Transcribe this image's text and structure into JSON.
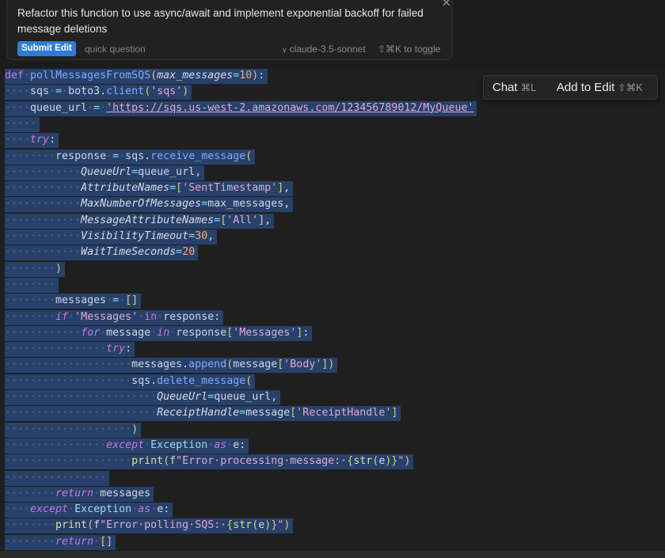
{
  "edit_panel": {
    "prompt": "Refactor this function to use async/await and implement exponential backoff for failed message deletions",
    "submit_label": "Submit Edit",
    "quick_question": "quick question",
    "model": "claude-3.5-sonnet",
    "toggle_hint": "⇧⌘K to toggle",
    "close_icon": "close-icon"
  },
  "chat_popup": {
    "chat_label": "Chat",
    "chat_shortcut": "⌘L",
    "add_label": "Add to Edit",
    "add_shortcut": "⇧⌘K"
  },
  "colors": {
    "selection": "#27416a",
    "submit": "#2e7bd6",
    "background": "#1f1f1f"
  },
  "code_lines": [
    {
      "indent": 0,
      "tokens": [
        [
          "kd",
          "def"
        ],
        [
          "ws",
          "·"
        ],
        [
          "fn",
          "pollMessagesFromSQS"
        ],
        [
          "par",
          "("
        ],
        [
          "prm",
          "max_messages"
        ],
        [
          "op",
          "="
        ],
        [
          "num",
          "10"
        ],
        [
          "par",
          ")"
        ],
        [
          "id",
          ":"
        ]
      ]
    },
    {
      "indent": 1,
      "tokens": [
        [
          "id",
          "sqs"
        ],
        [
          "ws",
          "·"
        ],
        [
          "op",
          "="
        ],
        [
          "ws",
          "·"
        ],
        [
          "id",
          "boto3."
        ],
        [
          "fn",
          "client"
        ],
        [
          "par",
          "("
        ],
        [
          "str",
          "'sqs'"
        ],
        [
          "par",
          ")"
        ]
      ]
    },
    {
      "indent": 1,
      "tokens": [
        [
          "id",
          "queue_url"
        ],
        [
          "ws",
          "·"
        ],
        [
          "op",
          "="
        ],
        [
          "ws",
          "·"
        ],
        [
          "url",
          "'https://sqs.us-west-2.amazonaws.com/123456789012/MyQueue'"
        ]
      ]
    },
    {
      "indent": 1,
      "tokens": [
        [
          "ws",
          "·"
        ]
      ]
    },
    {
      "indent": 1,
      "tokens": [
        [
          "kw",
          "try"
        ],
        [
          "id",
          ":"
        ]
      ]
    },
    {
      "indent": 2,
      "tokens": [
        [
          "id",
          "response"
        ],
        [
          "ws",
          "·"
        ],
        [
          "op",
          "="
        ],
        [
          "ws",
          "·"
        ],
        [
          "id",
          "sqs."
        ],
        [
          "fn",
          "receive_message"
        ],
        [
          "par",
          "("
        ]
      ]
    },
    {
      "indent": 3,
      "tokens": [
        [
          "prm",
          "QueueUrl"
        ],
        [
          "op",
          "="
        ],
        [
          "id",
          "queue_url,"
        ]
      ]
    },
    {
      "indent": 3,
      "tokens": [
        [
          "prm",
          "AttributeNames"
        ],
        [
          "op",
          "="
        ],
        [
          "par",
          "["
        ],
        [
          "str",
          "'SentTimestamp'"
        ],
        [
          "par",
          "]"
        ],
        [
          "id",
          ","
        ]
      ]
    },
    {
      "indent": 3,
      "tokens": [
        [
          "prm",
          "MaxNumberOfMessages"
        ],
        [
          "op",
          "="
        ],
        [
          "id",
          "max_messages,"
        ]
      ]
    },
    {
      "indent": 3,
      "tokens": [
        [
          "prm",
          "MessageAttributeNames"
        ],
        [
          "op",
          "="
        ],
        [
          "par",
          "["
        ],
        [
          "str",
          "'All'"
        ],
        [
          "par",
          "]"
        ],
        [
          "id",
          ","
        ]
      ]
    },
    {
      "indent": 3,
      "tokens": [
        [
          "prm",
          "VisibilityTimeout"
        ],
        [
          "op",
          "="
        ],
        [
          "num",
          "30"
        ],
        [
          "id",
          ","
        ]
      ]
    },
    {
      "indent": 3,
      "tokens": [
        [
          "prm",
          "WaitTimeSeconds"
        ],
        [
          "op",
          "="
        ],
        [
          "num",
          "20"
        ]
      ]
    },
    {
      "indent": 2,
      "tokens": [
        [
          "par",
          ")"
        ]
      ]
    },
    {
      "indent": 2,
      "tokens": []
    },
    {
      "indent": 2,
      "tokens": [
        [
          "id",
          "messages"
        ],
        [
          "ws",
          "·"
        ],
        [
          "op",
          "="
        ],
        [
          "ws",
          "·"
        ],
        [
          "par",
          "[]"
        ]
      ]
    },
    {
      "indent": 2,
      "tokens": [
        [
          "kw",
          "if"
        ],
        [
          "ws",
          "·"
        ],
        [
          "str",
          "'Messages'"
        ],
        [
          "ws",
          "·"
        ],
        [
          "kd",
          "in"
        ],
        [
          "ws",
          "·"
        ],
        [
          "id",
          "response:"
        ]
      ]
    },
    {
      "indent": 3,
      "tokens": [
        [
          "kw",
          "for"
        ],
        [
          "ws",
          "·"
        ],
        [
          "id",
          "message"
        ],
        [
          "ws",
          "·"
        ],
        [
          "kw",
          "in"
        ],
        [
          "ws",
          "·"
        ],
        [
          "id",
          "response"
        ],
        [
          "par",
          "["
        ],
        [
          "str",
          "'Messages'"
        ],
        [
          "par",
          "]"
        ],
        [
          "id",
          ":"
        ]
      ]
    },
    {
      "indent": 4,
      "tokens": [
        [
          "kw",
          "try"
        ],
        [
          "id",
          ":"
        ]
      ]
    },
    {
      "indent": 5,
      "tokens": [
        [
          "id",
          "messages."
        ],
        [
          "fn",
          "append"
        ],
        [
          "par",
          "("
        ],
        [
          "id",
          "message"
        ],
        [
          "par",
          "["
        ],
        [
          "str",
          "'Body'"
        ],
        [
          "par",
          "]"
        ],
        [
          "par",
          ")"
        ]
      ]
    },
    {
      "indent": 5,
      "tokens": [
        [
          "id",
          "sqs."
        ],
        [
          "fn",
          "delete_message"
        ],
        [
          "par",
          "("
        ]
      ]
    },
    {
      "indent": 6,
      "tokens": [
        [
          "prm",
          "QueueUrl"
        ],
        [
          "op",
          "="
        ],
        [
          "id",
          "queue_url,"
        ]
      ]
    },
    {
      "indent": 6,
      "tokens": [
        [
          "prm",
          "ReceiptHandle"
        ],
        [
          "op",
          "="
        ],
        [
          "id",
          "message"
        ],
        [
          "par",
          "["
        ],
        [
          "str",
          "'ReceiptHandle'"
        ],
        [
          "par",
          "]"
        ]
      ]
    },
    {
      "indent": 5,
      "tokens": [
        [
          "par",
          ")"
        ]
      ]
    },
    {
      "indent": 4,
      "tokens": [
        [
          "kw",
          "except"
        ],
        [
          "ws",
          "·"
        ],
        [
          "cls",
          "Exception"
        ],
        [
          "ws",
          "·"
        ],
        [
          "kw",
          "as"
        ],
        [
          "ws",
          "·"
        ],
        [
          "id",
          "e:"
        ]
      ]
    },
    {
      "indent": 5,
      "tokens": [
        [
          "bi",
          "print"
        ],
        [
          "par",
          "("
        ],
        [
          "id",
          "f"
        ],
        [
          "str",
          "\"Error·processing·message:·"
        ],
        [
          "par",
          "{"
        ],
        [
          "bi",
          "str"
        ],
        [
          "par",
          "("
        ],
        [
          "id",
          "e"
        ],
        [
          "par",
          ")"
        ],
        [
          "par",
          "}"
        ],
        [
          "str",
          "\""
        ],
        [
          "par",
          ")"
        ]
      ]
    },
    {
      "indent": 4,
      "tokens": []
    },
    {
      "indent": 2,
      "tokens": [
        [
          "kw",
          "return"
        ],
        [
          "ws",
          "·"
        ],
        [
          "id",
          "messages"
        ]
      ]
    },
    {
      "indent": 1,
      "tokens": [
        [
          "kw",
          "except"
        ],
        [
          "ws",
          "·"
        ],
        [
          "cls",
          "Exception"
        ],
        [
          "ws",
          "·"
        ],
        [
          "kw",
          "as"
        ],
        [
          "ws",
          "·"
        ],
        [
          "id",
          "e:"
        ]
      ]
    },
    {
      "indent": 2,
      "tokens": [
        [
          "bi",
          "print"
        ],
        [
          "par",
          "("
        ],
        [
          "id",
          "f"
        ],
        [
          "str",
          "\"Error·polling·SQS:·"
        ],
        [
          "par",
          "{"
        ],
        [
          "bi",
          "str"
        ],
        [
          "par",
          "("
        ],
        [
          "id",
          "e"
        ],
        [
          "par",
          ")"
        ],
        [
          "par",
          "}"
        ],
        [
          "str",
          "\""
        ],
        [
          "par",
          ")"
        ]
      ]
    },
    {
      "indent": 2,
      "tokens": [
        [
          "kw",
          "return"
        ],
        [
          "ws",
          "·"
        ],
        [
          "par",
          "[]"
        ]
      ]
    }
  ]
}
